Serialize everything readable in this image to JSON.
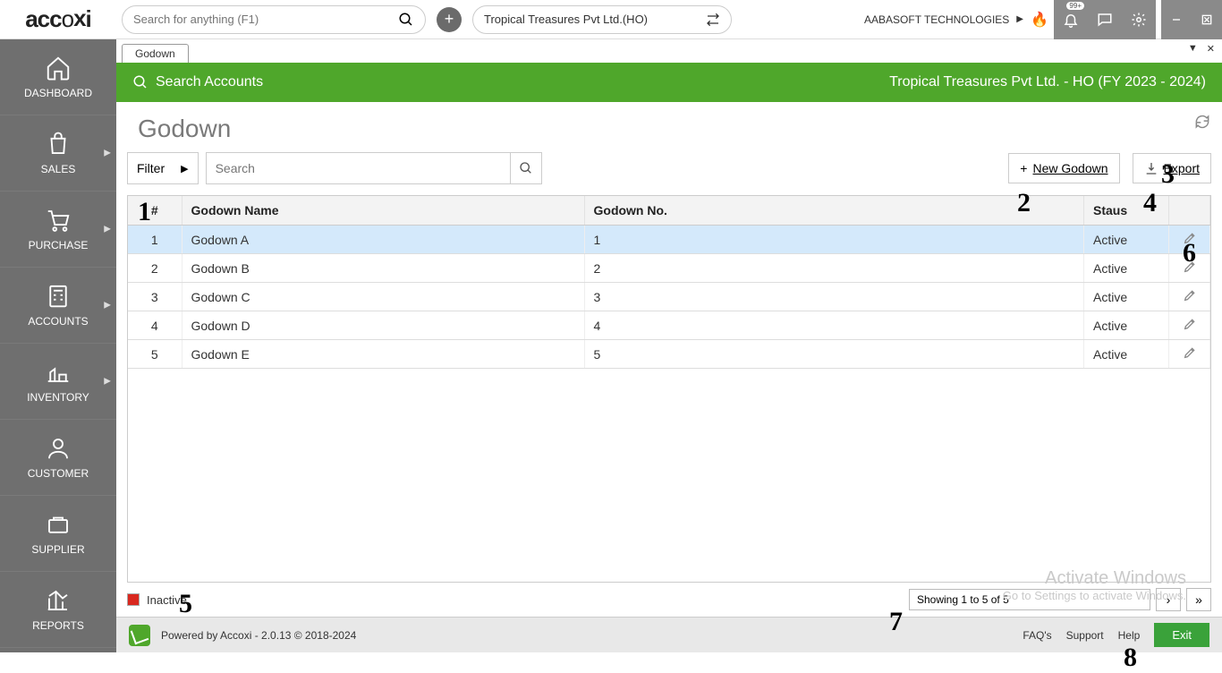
{
  "logo": "accoxi",
  "search_placeholder": "Search for anything (F1)",
  "company": "Tropical Treasures Pvt Ltd.(HO)",
  "tenant": "AABASOFT TECHNOLOGIES",
  "badge": "99+",
  "sidebar": [
    {
      "label": "DASHBOARD"
    },
    {
      "label": "SALES"
    },
    {
      "label": "PURCHASE"
    },
    {
      "label": "ACCOUNTS"
    },
    {
      "label": "INVENTORY"
    },
    {
      "label": "CUSTOMER"
    },
    {
      "label": "SUPPLIER"
    },
    {
      "label": "REPORTS"
    }
  ],
  "tab": "Godown",
  "greenbar": {
    "search": "Search Accounts",
    "context": "Tropical Treasures Pvt Ltd. - HO (FY 2023 - 2024)"
  },
  "page_title": "Godown",
  "filter_label": "Filter",
  "table_search_placeholder": "Search",
  "btn_new": "New Godown",
  "btn_export": "Export",
  "columns": {
    "num": "#",
    "name": "Godown Name",
    "no": "Godown No.",
    "status": "Staus"
  },
  "rows": [
    {
      "n": "1",
      "name": "Godown A",
      "no": "1",
      "status": "Active"
    },
    {
      "n": "2",
      "name": "Godown B",
      "no": "2",
      "status": "Active"
    },
    {
      "n": "3",
      "name": "Godown C",
      "no": "3",
      "status": "Active"
    },
    {
      "n": "4",
      "name": "Godown D",
      "no": "4",
      "status": "Active"
    },
    {
      "n": "5",
      "name": "Godown E",
      "no": "5",
      "status": "Active"
    }
  ],
  "legend": "Inactive",
  "pager_info": "Showing 1 to 5 of 5",
  "footer": {
    "powered": "Powered by Accoxi - 2.0.13 © 2018-2024",
    "faq": "FAQ's",
    "support": "Support",
    "help": "Help",
    "exit": "Exit"
  },
  "watermark": {
    "title": "Activate Windows",
    "sub": "Go to Settings to activate Windows."
  },
  "annotations": [
    "1",
    "2",
    "3",
    "4",
    "5",
    "6",
    "7",
    "8"
  ]
}
